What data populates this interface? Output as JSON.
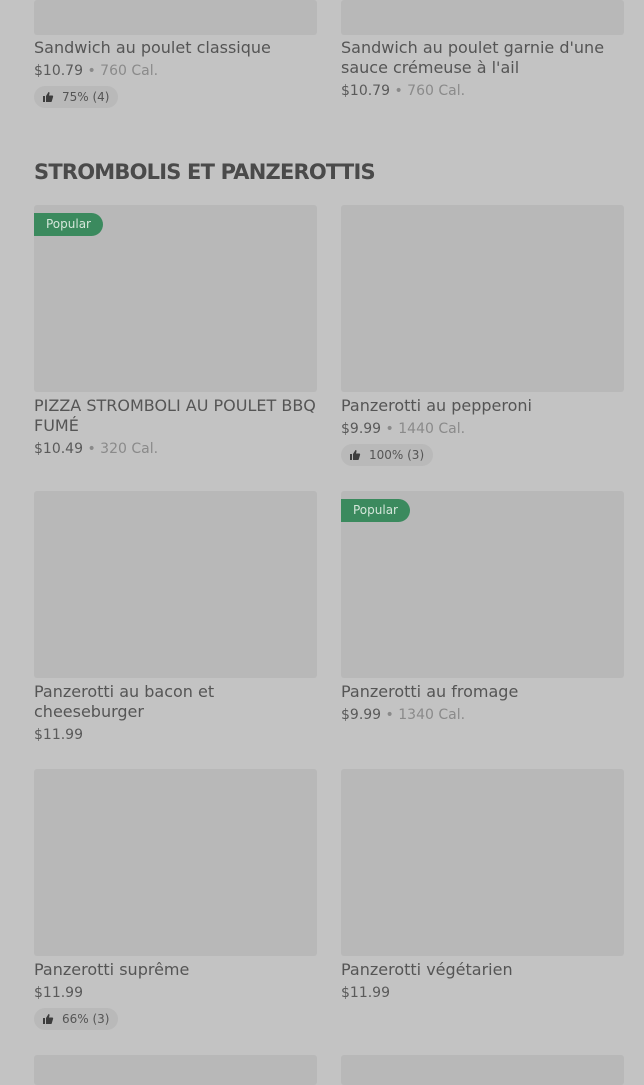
{
  "top_items": [
    {
      "name": "Sandwich au poulet classique",
      "price": "$10.79",
      "sep": "•",
      "cal": "760 Cal.",
      "rating": "75% (4)"
    },
    {
      "name": "Sandwich au poulet garnie d'une sauce crémeuse à l'ail",
      "price": "$10.79",
      "sep": "•",
      "cal": "760 Cal."
    }
  ],
  "section": {
    "title": "STROMBOLIS ET PANZEROTTIS"
  },
  "items": [
    {
      "badge": "Popular",
      "name": "PIZZA STROMBOLI AU POULET BBQ FUMÉ",
      "price": "$10.49",
      "sep": "•",
      "cal": "320 Cal."
    },
    {
      "name": "Panzerotti au pepperoni",
      "price": "$9.99",
      "sep": "•",
      "cal": "1440 Cal.",
      "rating": "100% (3)"
    },
    {
      "name": "Panzerotti au bacon et cheeseburger",
      "price": "$11.99"
    },
    {
      "badge": "Popular",
      "name": "Panzerotti au fromage",
      "price": "$9.99",
      "sep": "•",
      "cal": "1340 Cal."
    },
    {
      "name": "Panzerotti suprême",
      "price": "$11.99",
      "rating": "66% (3)"
    },
    {
      "name": "Panzerotti végétarien",
      "price": "$11.99"
    }
  ],
  "colors": {
    "background": "#c3c3c3",
    "badge": "#3b8a5e",
    "image_placeholder": "#b8b8b8"
  },
  "icons": {
    "rating": "thumbs-up-icon"
  }
}
